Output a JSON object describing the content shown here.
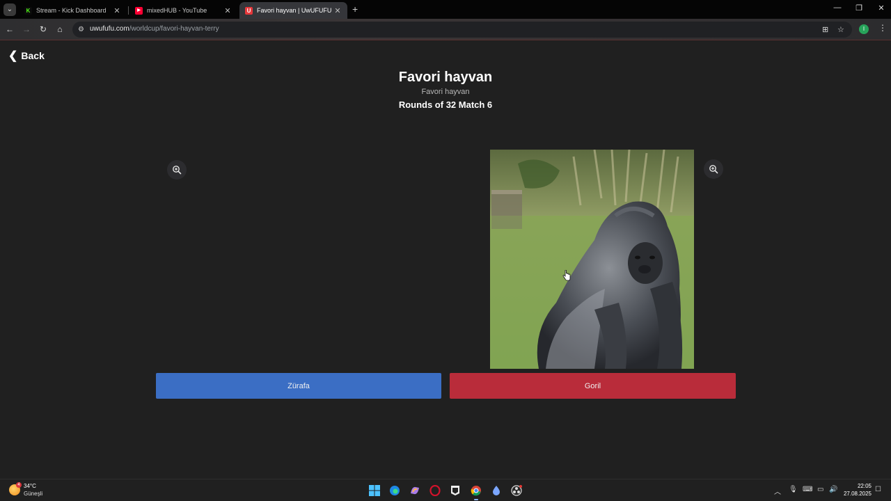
{
  "browser": {
    "tabs": [
      {
        "title": "Stream - Kick Dashboard",
        "icon": "kick-icon",
        "color": "#53fc18",
        "active": false
      },
      {
        "title": "mixedHUB - YouTube",
        "icon": "youtube-icon",
        "color": "#ff0033",
        "active": false
      },
      {
        "title": "Favori hayvan | UwUFUFU",
        "icon": "uwufufu-icon",
        "color": "#e5383b",
        "active": true
      }
    ],
    "url_domain": "uwufufu.com",
    "url_path": "/worldcup/favori-hayvan-terry",
    "profile_initial": "I"
  },
  "page": {
    "back_label": "Back",
    "title": "Favori hayvan",
    "subtitle": "Favori hayvan",
    "round_label": "Rounds of 32 Match 6",
    "left_choice": {
      "label": "Zürafa",
      "color": "#3b6ec4"
    },
    "right_choice": {
      "label": "Goril",
      "color": "#b92c3a"
    }
  },
  "taskbar": {
    "weather_temp": "34°C",
    "weather_desc": "Güneşli",
    "weather_badge": "4",
    "time": "22:05",
    "date": "27.08.2025"
  }
}
